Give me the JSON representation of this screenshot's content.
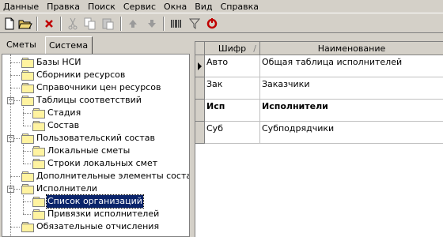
{
  "menu": [
    "Данные",
    "Правка",
    "Поиск",
    "Сервис",
    "Окна",
    "Вид",
    "Справка"
  ],
  "toolbar": {
    "icons": [
      "new-document-icon",
      "open-folder-icon",
      "delete-icon",
      "cut-icon",
      "copy-icon",
      "paste-icon",
      "arrow-up-icon",
      "arrow-down-icon",
      "barcode-icon",
      "filter-icon",
      "refresh-icon"
    ]
  },
  "tabs": [
    "Сметы",
    "Система"
  ],
  "tree": [
    {
      "label": "Базы НСИ",
      "level": 0,
      "expander": ""
    },
    {
      "label": "Сборники ресурсов",
      "level": 0,
      "expander": ""
    },
    {
      "label": "Справочники цен ресурсов",
      "level": 0,
      "expander": ""
    },
    {
      "label": "Таблицы соответствий",
      "level": 0,
      "expander": "−"
    },
    {
      "label": "Стадия",
      "level": 1,
      "expander": ""
    },
    {
      "label": "Состав",
      "level": 1,
      "expander": ""
    },
    {
      "label": "Пользовательский состав",
      "level": 0,
      "expander": "−"
    },
    {
      "label": "Локальные сметы",
      "level": 1,
      "expander": ""
    },
    {
      "label": "Строки локальных смет",
      "level": 1,
      "expander": ""
    },
    {
      "label": "Дополнительные элементы состава",
      "level": 0,
      "expander": ""
    },
    {
      "label": "Исполнители",
      "level": 0,
      "expander": "−"
    },
    {
      "label": "Список организаций",
      "level": 1,
      "expander": "",
      "selected": true
    },
    {
      "label": "Привязки исполнителей",
      "level": 1,
      "expander": ""
    },
    {
      "label": "Обязательные отчисления",
      "level": 0,
      "expander": ""
    }
  ],
  "grid": {
    "columns": [
      "Шифр",
      "Наименование"
    ],
    "sort_indicator": "/",
    "rows": [
      {
        "code": "Авто",
        "name": "Общая таблица исполнителей",
        "current": true,
        "bold": false
      },
      {
        "code": "Зак",
        "name": "Заказчики",
        "current": false,
        "bold": false
      },
      {
        "code": "Исп",
        "name": "Исполнители",
        "current": false,
        "bold": true
      },
      {
        "code": "Суб",
        "name": "Субподрядчики",
        "current": false,
        "bold": false
      }
    ]
  }
}
